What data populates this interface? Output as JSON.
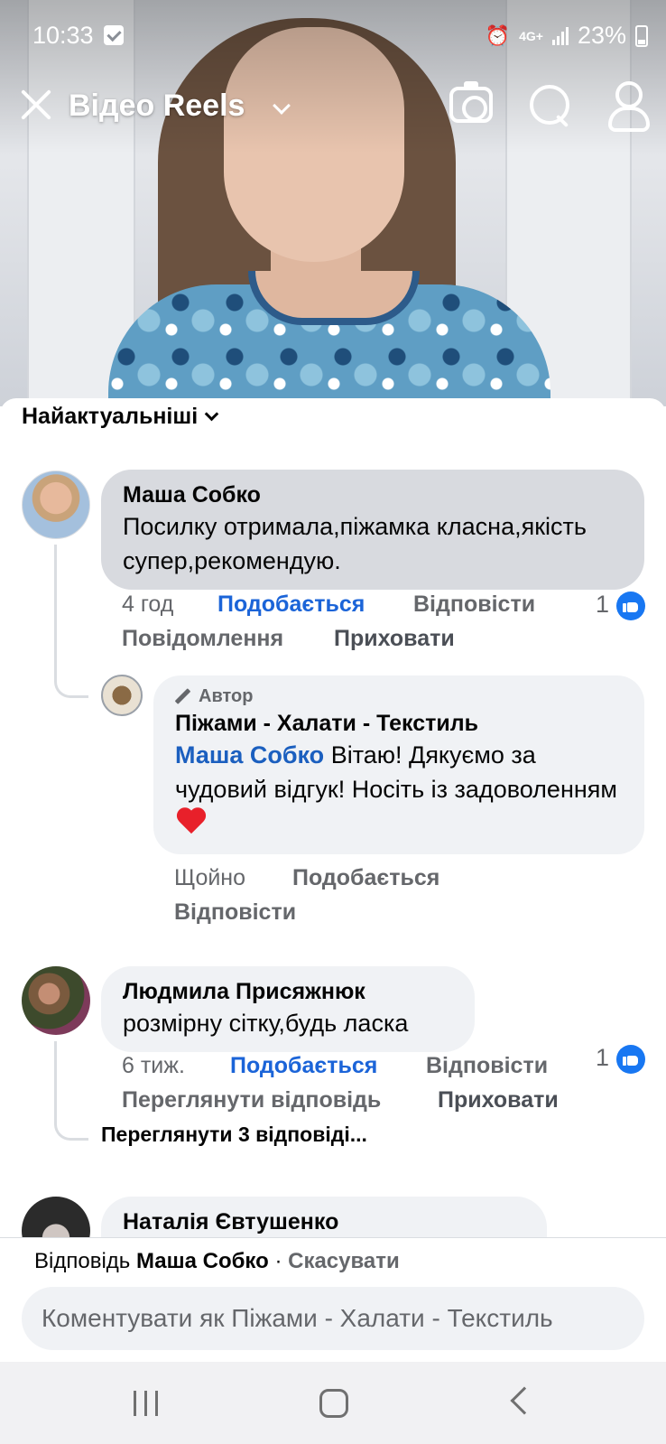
{
  "status_bar": {
    "time": "10:33",
    "network": "4G+",
    "battery": "23%"
  },
  "header": {
    "title": "Відео Reels",
    "icons": [
      "close-icon",
      "chevron-down-icon",
      "camera-icon",
      "search-icon",
      "profile-icon"
    ]
  },
  "sort": {
    "label": "Найактуальніші"
  },
  "comments": [
    {
      "author": "Маша Собко",
      "text": "Посилку отримала,піжамка класна,якість супер,рекомендую.",
      "time": "4 год",
      "like_label": "Подобається",
      "reply_label": "Відповісти",
      "message_label": "Повідомлення",
      "hide_label": "Приховати",
      "reactions": "1",
      "reply": {
        "badge": "Автор",
        "author": "Піжами - Халати - Текстиль",
        "mention": "Маша Собко",
        "text": " Вітаю! Дякуємо за чудовий відгук! Носіть із задоволенням",
        "time": "Щойно",
        "like_label": "Подобається",
        "reply_label": "Відповісти"
      }
    },
    {
      "author": "Людмила Присяжнюк",
      "text": "розмірну сітку,будь ласка",
      "time": "6 тиж.",
      "like_label": "Подобається",
      "reply_label": "Відповісти",
      "view_reply_label": "Переглянути відповідь",
      "hide_label": "Приховати",
      "reactions": "1",
      "view_replies": "Переглянути 3 відповіді..."
    },
    {
      "author": "Наталія Євтушенко"
    }
  ],
  "reply_bar": {
    "prefix": "Відповідь",
    "target": "Маша Собко",
    "separator": " · ",
    "cancel": "Скасувати",
    "placeholder": "Коментувати як Піжами - Халати - Текстиль"
  },
  "colors": {
    "link_blue": "#1b64d8",
    "mention_blue": "#1b5fbf",
    "like_badge": "#1877f2",
    "bubble": "#f0f2f5",
    "bubble_selected": "#d8dadf",
    "muted_text": "#65676b"
  }
}
